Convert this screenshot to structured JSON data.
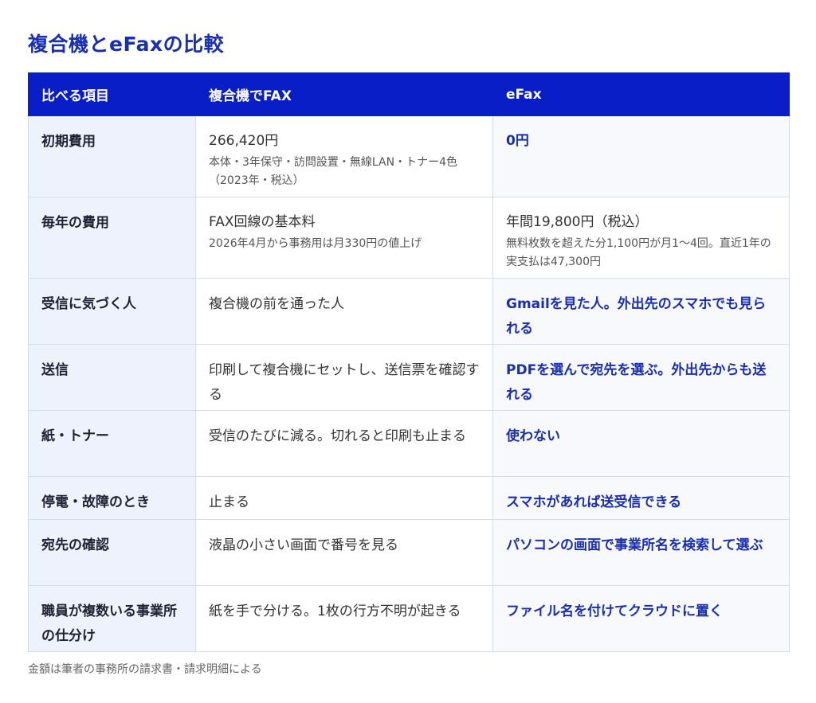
{
  "title": "複合機とeFaxの比較",
  "table": {
    "headers": [
      "比べる項目",
      "複合機でFAX",
      "eFax"
    ],
    "rows": [
      {
        "item": "初期費用",
        "fax": {
          "main": "266,420円",
          "sub": "本体・3年保守・訪問設置・無線LAN・トナー4色（2023年・税込）"
        },
        "efax": {
          "main": "0円"
        }
      },
      {
        "item": "毎年の費用",
        "fax": {
          "main": "FAX回線の基本料",
          "sub": "2026年4月から事務用は月330円の値上げ"
        },
        "efax": {
          "main": "年間19,800円（税込）",
          "sub": "無料枚数を超えた分1,100円が月1〜4回。直近1年の実支払は47,300円"
        }
      },
      {
        "item": "受信に気づく人",
        "fax": {
          "main": "複合機の前を通った人"
        },
        "efax": {
          "main": "Gmailを見た人。外出先のスマホでも見られる"
        }
      },
      {
        "item": "送信",
        "fax": {
          "main": "印刷して複合機にセットし、送信票を確認する"
        },
        "efax": {
          "main": "PDFを選んで宛先を選ぶ。外出先からも送れる"
        }
      },
      {
        "item": "紙・トナー",
        "fax": {
          "main": "受信のたびに減る。切れると印刷も止まる"
        },
        "efax": {
          "main": "使わない"
        }
      },
      {
        "item": "停電・故障のとき",
        "fax": {
          "main": "止まる"
        },
        "efax": {
          "main": "スマホがあれば送受信できる"
        }
      },
      {
        "item": "宛先の確認",
        "fax": {
          "main": "液晶の小さい画面で番号を見る"
        },
        "efax": {
          "main": "パソコンの画面で事業所名を検索して選ぶ"
        }
      },
      {
        "item": "職員が複数いる事業所の仕分け",
        "fax": {
          "main": "紙を手で分ける。1枚の行方不明が起きる"
        },
        "efax": {
          "main": "ファイル名を付けてクラウドに置く"
        }
      }
    ]
  },
  "footnote": "金額は筆者の事務所の請求書・請求明細による",
  "colors": {
    "header_bg": "#0a1ec8",
    "accent_text": "#1a2fb0",
    "item_bg": "#eef2fd"
  }
}
